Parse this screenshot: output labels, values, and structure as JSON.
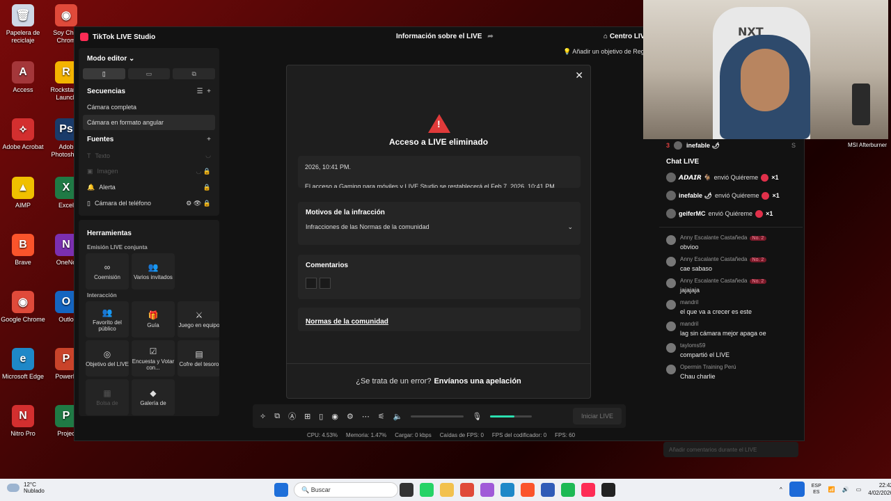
{
  "desktop_icons": [
    {
      "label": "Papelera de reciclaje",
      "color": "#cfd8e6",
      "glyph": "🗑"
    },
    {
      "label": "Soy Char Chrom",
      "color": "#e04a3a",
      "glyph": "◉"
    },
    {
      "label": "Access",
      "color": "#a4373a",
      "glyph": "A"
    },
    {
      "label": "Rockstar G Launch",
      "color": "#f4b400",
      "glyph": "R"
    },
    {
      "label": "Adobe Acrobat",
      "color": "#d32f2f",
      "glyph": "⟡"
    },
    {
      "label": "Adob Photoshop",
      "color": "#1a3b6a",
      "glyph": "Ps"
    },
    {
      "label": "AIMP",
      "color": "#f0c000",
      "glyph": "▲"
    },
    {
      "label": "Excel",
      "color": "#1f7a45",
      "glyph": "X"
    },
    {
      "label": "Brave",
      "color": "#fb542b",
      "glyph": "B"
    },
    {
      "label": "OneNo",
      "color": "#7b2fb0",
      "glyph": "N"
    },
    {
      "label": "Google Chrome",
      "color": "#e04a3a",
      "glyph": "◉"
    },
    {
      "label": "Outlo",
      "color": "#1565c0",
      "glyph": "O"
    },
    {
      "label": "Microsoft Edge",
      "color": "#1e88c8",
      "glyph": "e"
    },
    {
      "label": "PowerP",
      "color": "#c9432a",
      "glyph": "P"
    },
    {
      "label": "Nitro Pro",
      "color": "#d32f2f",
      "glyph": "N"
    },
    {
      "label": "Projec",
      "color": "#1f7a45",
      "glyph": "P"
    }
  ],
  "window": {
    "app_title": "TikTok LIVE Studio",
    "center_title": "Información sobre el LIVE",
    "right_title": "Centro LIV",
    "goal": "Añadir un objetivo de Rega"
  },
  "left": {
    "editor_mode": "Modo editor",
    "sequences_title": "Secuencias",
    "sequences": [
      "Cámara completa",
      "Cámara en formato angular"
    ],
    "sources_title": "Fuentes",
    "sources": [
      "Texto",
      "Imagen",
      "Alerta",
      "Cámara del teléfono"
    ],
    "tools_title": "Herramientas",
    "joint_title": "Emisión LIVE conjunta",
    "joint_tools": [
      "Coemisión",
      "Varios invitados"
    ],
    "interaction_title": "Interacción",
    "interaction_tools": [
      "Favorito del público",
      "Guía",
      "Juego en equipo",
      "Objetivo del LIVE",
      "Encuesta y Votar con...",
      "Cofre del tesoro",
      "Bolsa de",
      "Galería de"
    ]
  },
  "modal": {
    "title": "Acceso a LIVE eliminado",
    "info_line1": "2026, 10:41 PM.",
    "info_line2": "El acceso a Gaming para móviles y LIVE Studio se restablecerá el Feb 7, 2026, 10:41 PM.",
    "reasons_title": "Motivos de la infracción",
    "reasons_value": "Infracciones de las Normas de la comunidad",
    "comments_title": "Comentarios",
    "guidelines_link": "Normas de la comunidad",
    "footer_question": "¿Se trata de un error?",
    "footer_action": "Envíanos una apelación"
  },
  "bottombar": {
    "start_label": "Iniciar LIVE",
    "mic_level": 0.58
  },
  "stats": {
    "cpu": "CPU:  4.53%",
    "memory": "Memoria:  1.47%",
    "upload": "Cargar:  0 kbps",
    "fps_drops": "Caídas de FPS:  0",
    "encoder_fps": "FPS del codificador:  0",
    "fps": "FPS:  60"
  },
  "right": {
    "rank": {
      "pos": "3",
      "name": "inefable 🌶",
      "score": "S"
    },
    "chat_title": "Chat LIVE",
    "gifts": [
      {
        "user": "𝘼𝘿𝘼𝙄𝙍 🐐",
        "text": "envió Quiéreme",
        "count": "×1"
      },
      {
        "user": "inefable 🌶",
        "text": "envió Quiéreme",
        "count": "×1"
      },
      {
        "user": "geiferMC",
        "text": "envió Quiéreme",
        "count": "×1"
      }
    ],
    "messages": [
      {
        "user": "Anny Escalante Castañeda",
        "badge": "No. 2",
        "text": "obvioo"
      },
      {
        "user": "Anny Escalante Castañeda",
        "badge": "No. 2",
        "text": "cae sabaso"
      },
      {
        "user": "Anny Escalante Castañeda",
        "badge": "No. 2",
        "text": "jajajaja"
      },
      {
        "user": "mandril",
        "badge": "",
        "text": "el que va a crecer es este"
      },
      {
        "user": "mandril",
        "badge": "",
        "text": "lag sin cámara mejor apaga oe"
      },
      {
        "user": "tayloms59",
        "badge": "",
        "text": "compartió el LIVE"
      },
      {
        "user": "Opermin Training Perú",
        "badge": "",
        "text": "Chau charlie"
      }
    ],
    "chat_placeholder": "Añadir comentarios durante el LIVE"
  },
  "webcam": {
    "chair_brand": "NXT"
  },
  "msi_label": "MSI Afterburner",
  "taskbar": {
    "temp": "12°C",
    "weather": "Nublado",
    "search_placeholder": "Buscar",
    "lang_top": "ESP",
    "lang_bottom": "ES",
    "time": "22:42",
    "date": "4/02/2026"
  }
}
